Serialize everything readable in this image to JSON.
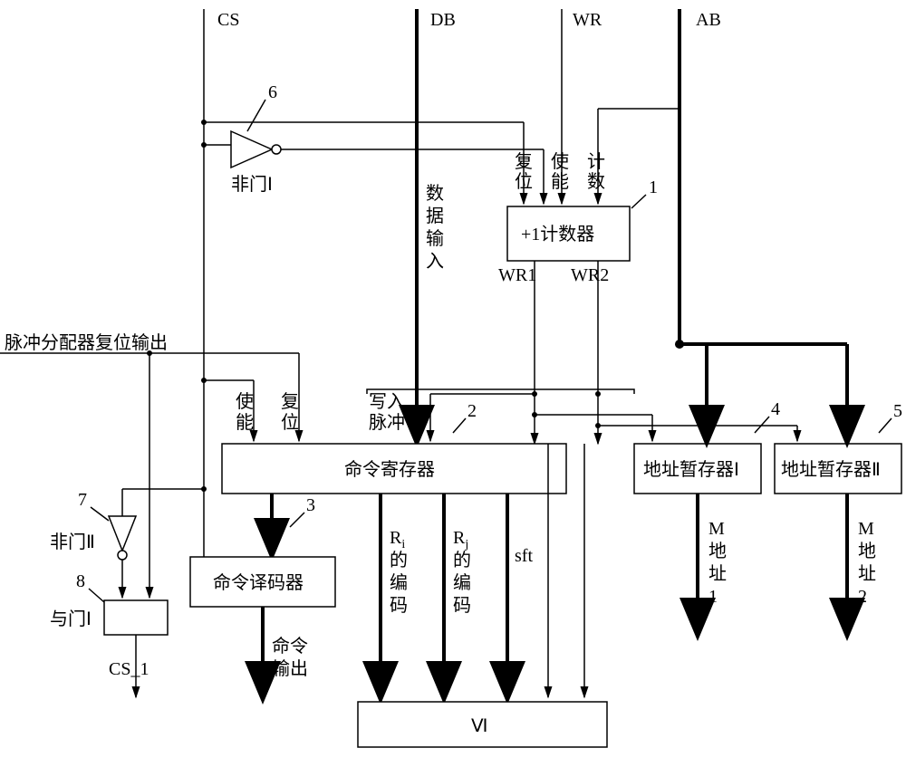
{
  "buses": {
    "cs": "CS",
    "db": "DB",
    "wr": "WR",
    "ab": "AB"
  },
  "gates": {
    "not1": "非门Ⅰ",
    "not2": "非门Ⅱ",
    "and1": "与门Ⅰ"
  },
  "blocks": {
    "counter": "+1计数器",
    "cmd_reg": "命令寄存器",
    "cmd_dec": "命令译码器",
    "addr_reg1": "地址暂存器Ⅰ",
    "addr_reg2": "地址暂存器Ⅱ",
    "vi": "Ⅵ"
  },
  "signals": {
    "reset": "复",
    "reset2": "位",
    "enable": "使",
    "enable2": "能",
    "count": "计",
    "count2": "数",
    "data_in_col": [
      "数",
      "据",
      "输",
      "入"
    ],
    "wr1": "WR1",
    "wr2": "WR2",
    "pulse_reset": "脉冲分配器复位输出",
    "write_pulse1": "写入",
    "write_pulse2": "脉冲",
    "ri_code1": "R",
    "ri_sub": "i",
    "ri_code2": "的",
    "ri_code3": "编",
    "ri_code4": "码",
    "rj_code1": "R",
    "rj_sub": "j",
    "rj_code2": "的",
    "rj_code3": "编",
    "rj_code4": "码",
    "sft": "sft",
    "m_addr_1": [
      "M",
      "地",
      "址",
      "1"
    ],
    "m_addr_2": [
      "M",
      "地",
      "址",
      "2"
    ],
    "cmd_out1": "命令",
    "cmd_out2": "输出",
    "cs_1": "CS_1"
  },
  "numbers": {
    "n1": "1",
    "n2": "2",
    "n3": "3",
    "n4": "4",
    "n5": "5",
    "n6": "6",
    "n7": "7",
    "n8": "8"
  }
}
